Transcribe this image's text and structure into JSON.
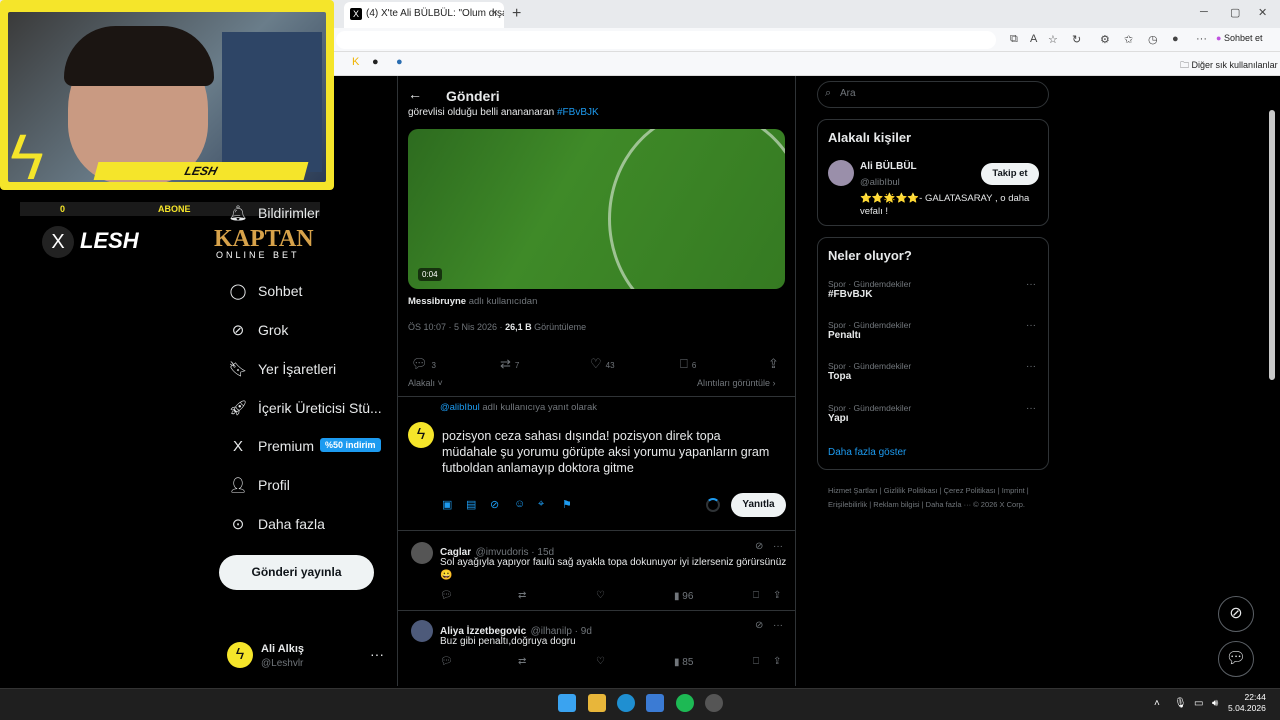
{
  "browser": {
    "tab_title": "(4) X'te Ali BÜLBÜL: \"Olum dışarda",
    "tab_close": "×",
    "new_tab": "+",
    "window_minimize": "─",
    "window_maximize": "▢",
    "window_close": "✕",
    "sohbet_label": "Sohbet et",
    "other_bookmarks": "Diğer sık kullanılanlar"
  },
  "overlay": {
    "streamer_label": "LESH",
    "abone_count": "0",
    "abone_label": "ABONE",
    "brand_text": "LESH",
    "sponsor": "KAPTAN",
    "sponsor_sub": "ONLINE BET"
  },
  "sidebar": {
    "items": [
      {
        "label": "Bildirimler",
        "icon": "bell-icon"
      },
      {
        "label": "Grok",
        "icon": "grok-icon"
      },
      {
        "label": "Sohbet",
        "icon": "chat-icon"
      },
      {
        "label": "Grok",
        "icon": "grok-icon"
      },
      {
        "label": "Yer İşaretleri",
        "icon": "bookmark-icon"
      },
      {
        "label": "İçerik Üreticisi Stü...",
        "icon": "rocket-icon"
      },
      {
        "label": "Premium",
        "icon": "x-icon"
      },
      {
        "label": "Profil",
        "icon": "person-icon"
      },
      {
        "label": "Daha fazla",
        "icon": "more-circle-icon"
      }
    ],
    "premium_badge": "%50 indirim",
    "post_button": "Gönderi yayınla",
    "account_name": "Ali Alkış",
    "account_handle": "@Leshvlr",
    "account_more": "···"
  },
  "post": {
    "header": "Gönderi",
    "back": "←",
    "text_partial": "görevlisi olduğu belli anananaran",
    "hashtag": "#FBvBJK",
    "video_time": "0:04",
    "attribution_user": "Messibruyne",
    "attribution_suffix": "adlı kullanıcıdan",
    "timestamp": "ÖS 10:07 · 5 Nis 2026 ·",
    "views": "26,1 B",
    "views_label": "Görüntüleme",
    "replies": "3",
    "reposts": "7",
    "likes": "43",
    "bookmarks": "6",
    "related": "Alakalı",
    "quotes": "Alıntıları görüntüle"
  },
  "compose": {
    "reply_prefix": "@alibIbul",
    "reply_suffix": "adlı kullanıcıya yanıt olarak",
    "text": "pozisyon ceza sahası dışında! pozisyon direk topa müdahale şu yorumu görüpte aksi yorumu yapanların gram futboldan anlamayıp doktora gitme",
    "reply_button": "Yanıtla"
  },
  "replies": [
    {
      "name": "Caglar",
      "handle": "@imvudoris · 15d",
      "text": "Sol ayağıyla yapıyor faulü sağ ayakla topa dokunuyor iyi izlerseniz görürsünüz 😀",
      "views": "96"
    },
    {
      "name": "Aliya İzzetbegovic",
      "handle": "@ilhanilp · 9d",
      "text": "Buz gibi penaltı,doğruya dogru",
      "views": "85"
    }
  ],
  "right": {
    "search_placeholder": "Ara",
    "people_title": "Alakalı kişiler",
    "person_name": "Ali BÜLBÜL",
    "person_handle": "@alibIbul",
    "follow": "Takip et",
    "person_bio": "⭐⭐🌟⭐⭐- GALATASARAY , o daha vefalı !",
    "trends_title": "Neler oluyor?",
    "trends": [
      {
        "category": "Spor · Gündemdekiler",
        "name": "#FBvBJK"
      },
      {
        "category": "Spor · Gündemdekiler",
        "name": "Penaltı"
      },
      {
        "category": "Spor · Gündemdekiler",
        "name": "Topa"
      },
      {
        "category": "Spor · Gündemdekiler",
        "name": "Yapı"
      }
    ],
    "show_more": "Daha fazla göster",
    "footer": "Hizmet Şartları | Gizlilik Politikası | Çerez Politikası | Imprint | Erişilebilirlik | Reklam bilgisi | Daha fazla ··· © 2026 X Corp."
  },
  "taskbar": {
    "time": "22:44",
    "date": "5.04.2026"
  },
  "colors": {
    "accent": "#1d9bf0",
    "overlay_yellow": "#f5e52a"
  }
}
